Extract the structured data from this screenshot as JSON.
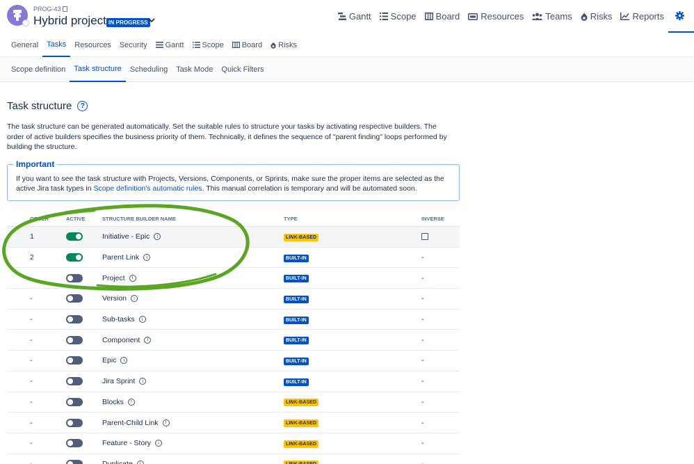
{
  "header": {
    "project_key": "PROG-43",
    "project_name": "Hybrid project",
    "status": "IN PROGRESS",
    "nav": [
      {
        "label": "Gantt",
        "icon": "gantt-icon"
      },
      {
        "label": "Scope",
        "icon": "scope-icon"
      },
      {
        "label": "Board",
        "icon": "board-icon"
      },
      {
        "label": "Resources",
        "icon": "resources-icon"
      },
      {
        "label": "Teams",
        "icon": "teams-icon"
      },
      {
        "label": "Risks",
        "icon": "risks-icon"
      },
      {
        "label": "Reports",
        "icon": "reports-icon"
      }
    ],
    "settings_icon": "gear-icon"
  },
  "tabs": [
    {
      "label": "General"
    },
    {
      "label": "Tasks",
      "active": true
    },
    {
      "label": "Resources"
    },
    {
      "label": "Security"
    },
    {
      "label": "Gantt",
      "icon": "gantt-icon"
    },
    {
      "label": "Scope",
      "icon": "scope-icon"
    },
    {
      "label": "Board",
      "icon": "board-icon"
    },
    {
      "label": "Risks",
      "icon": "risks-icon"
    }
  ],
  "subtabs": [
    {
      "label": "Scope definition"
    },
    {
      "label": "Task structure",
      "active": true
    },
    {
      "label": "Scheduling"
    },
    {
      "label": "Task Mode"
    },
    {
      "label": "Quick Filters"
    }
  ],
  "content": {
    "title": "Task structure",
    "description": "The task structure can be generated automatically. Set the suitable rules to structure your tasks by activating respective builders. The order of active builders specifies the business priority of them. Technically, it defines the sequence of \"parent finding\" loops performed by building the structure.",
    "important": {
      "title": "Important",
      "text_before": "If you want to see the task structure with Projects, Versions, Components, or Sprints, make sure the proper items are selected as the active Jira task types in ",
      "link": "Scope definition's automatic rules",
      "text_after": ". This manual correlation is temporary and will be automated soon."
    }
  },
  "table": {
    "headers": {
      "order": "ORDER",
      "active": "ACTIVE",
      "name": "STRUCTURE BUILDER NAME",
      "type": "TYPE",
      "inverse": "INVERSE"
    },
    "rows": [
      {
        "order": "1",
        "active": true,
        "name": "Initiative - Epic",
        "type": "LINK-BASED",
        "inverse": "checkbox",
        "highlight": true
      },
      {
        "order": "2",
        "active": true,
        "name": "Parent Link",
        "type": "BUILT-IN",
        "inverse": "-"
      },
      {
        "order": "-",
        "active": false,
        "name": "Project",
        "type": "BUILT-IN",
        "inverse": "-"
      },
      {
        "order": "-",
        "active": false,
        "name": "Version",
        "type": "BUILT-IN",
        "inverse": "-"
      },
      {
        "order": "-",
        "active": false,
        "name": "Sub-tasks",
        "type": "BUILT-IN",
        "inverse": "-"
      },
      {
        "order": "-",
        "active": false,
        "name": "Component",
        "type": "BUILT-IN",
        "inverse": "-"
      },
      {
        "order": "-",
        "active": false,
        "name": "Epic",
        "type": "BUILT-IN",
        "inverse": "-"
      },
      {
        "order": "-",
        "active": false,
        "name": "Jira Sprint",
        "type": "BUILT-IN",
        "inverse": "-"
      },
      {
        "order": "-",
        "active": false,
        "name": "Blocks",
        "type": "LINK-BASED",
        "inverse": "-"
      },
      {
        "order": "-",
        "active": false,
        "name": "Parent-Child Link",
        "type": "LINK-BASED",
        "inverse": "-"
      },
      {
        "order": "-",
        "active": false,
        "name": "Feature - Story",
        "type": "LINK-BASED",
        "inverse": "-"
      },
      {
        "order": "-",
        "active": false,
        "name": "Duplicate",
        "type": "LINK-BASED",
        "inverse": "-"
      }
    ]
  },
  "colors": {
    "accent": "#0052cc",
    "toggle_on": "#00875a",
    "toggle_off": "#505f79",
    "link_based": "#ffc400",
    "annotation": "#5aa623"
  }
}
